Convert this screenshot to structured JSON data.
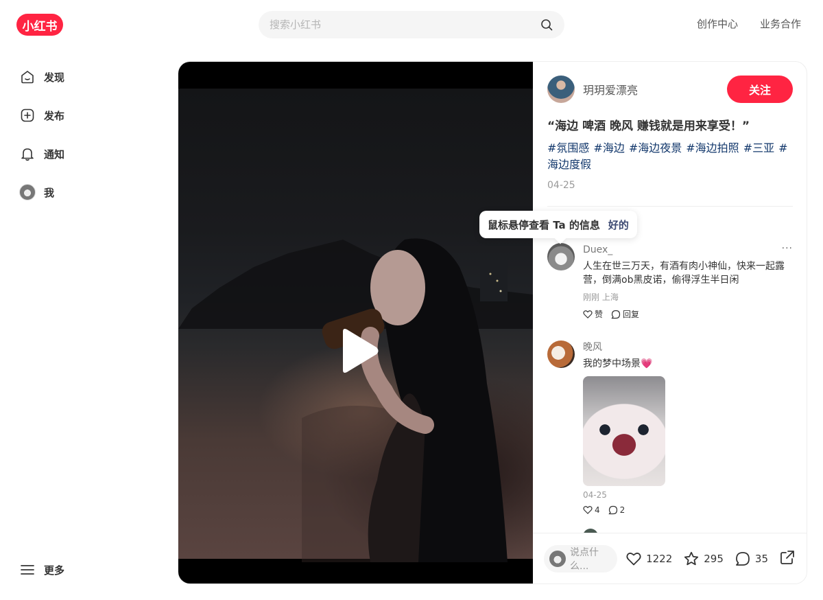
{
  "header": {
    "logo": "小红书",
    "search_placeholder": "搜索小红书",
    "links": [
      "创作中心",
      "业务合作"
    ]
  },
  "sidebar": {
    "items": [
      {
        "label": "发现",
        "icon": "home-icon"
      },
      {
        "label": "发布",
        "icon": "plus-square-icon"
      },
      {
        "label": "通知",
        "icon": "bell-icon"
      },
      {
        "label": "我",
        "icon": "avatar"
      }
    ],
    "more_label": "更多"
  },
  "tooltip": {
    "text": "鼠标悬停查看 Ta 的信息",
    "ok": "好的"
  },
  "note": {
    "author": "玥玥爱漂亮",
    "follow_label": "关注",
    "title": "“海边 啤酒 晚风 赚钱就是用来享受！”",
    "tags": [
      "#氛围感",
      "#海边",
      "#海边夜景",
      "#海边拍照",
      "#三亚",
      "#海边度假"
    ],
    "date": "04-25"
  },
  "comments": [
    {
      "name": "Duex_",
      "text": "人生在世三万天，有酒有肉小神仙，快来一起露营，倒满ob黑皮诺，偷得浮生半日闲",
      "meta": "刚刚 上海",
      "like_label": "赞",
      "reply_label": "回复",
      "more": "···"
    },
    {
      "name": "晚风",
      "text": "我的梦中场景💗",
      "date": "04-25",
      "likes": "4",
      "replies": "2"
    }
  ],
  "bottom": {
    "input_placeholder": "说点什么...",
    "likes": "1222",
    "collects": "295",
    "comments": "35"
  },
  "colors": {
    "brand": "#ff2442",
    "tag": "#13386c"
  }
}
